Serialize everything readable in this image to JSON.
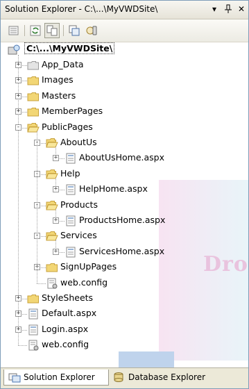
{
  "window": {
    "title": "Solution Explorer - C:\\...\\MyVWDSite\\",
    "dropdown_glyph": "▾",
    "pin_glyph": "⊥",
    "close_glyph": "✕"
  },
  "toolbar": {
    "buttons": [
      "properties-icon",
      "refresh-icon",
      "nest-related-files-icon",
      "copy-web-site-icon",
      "asp-net-configuration-icon"
    ]
  },
  "tree": {
    "root": "C:\\...\\MyVWDSite\\",
    "items": [
      {
        "label": "App_Data",
        "type": "folder-special",
        "level": 1,
        "expander": "+"
      },
      {
        "label": "Images",
        "type": "folder",
        "level": 1,
        "expander": "+"
      },
      {
        "label": "Masters",
        "type": "folder",
        "level": 1,
        "expander": "+"
      },
      {
        "label": "MemberPages",
        "type": "folder",
        "level": 1,
        "expander": "+"
      },
      {
        "label": "PublicPages",
        "type": "folder-open",
        "level": 1,
        "expander": "-"
      },
      {
        "label": "AboutUs",
        "type": "folder-open",
        "level": 2,
        "expander": "-"
      },
      {
        "label": "AboutUsHome.aspx",
        "type": "page",
        "level": 3,
        "expander": "+"
      },
      {
        "label": "Help",
        "type": "folder-open",
        "level": 2,
        "expander": "-"
      },
      {
        "label": "HelpHome.aspx",
        "type": "page",
        "level": 3,
        "expander": "+"
      },
      {
        "label": "Products",
        "type": "folder-open",
        "level": 2,
        "expander": "-"
      },
      {
        "label": "ProductsHome.aspx",
        "type": "page",
        "level": 3,
        "expander": "+"
      },
      {
        "label": "Services",
        "type": "folder-open",
        "level": 2,
        "expander": "-"
      },
      {
        "label": "ServicesHome.aspx",
        "type": "page",
        "level": 3,
        "expander": "+"
      },
      {
        "label": "SignUpPages",
        "type": "folder",
        "level": 2,
        "expander": "+"
      },
      {
        "label": "web.config",
        "type": "config",
        "level": 2,
        "expander": ""
      },
      {
        "label": "StyleSheets",
        "type": "folder",
        "level": 1,
        "expander": "+"
      },
      {
        "label": "Default.aspx",
        "type": "page",
        "level": 1,
        "expander": "+"
      },
      {
        "label": "Login.aspx",
        "type": "page",
        "level": 1,
        "expander": "+"
      },
      {
        "label": "web.config",
        "type": "config",
        "level": 1,
        "expander": ""
      }
    ]
  },
  "watermark": {
    "text": "Dro"
  },
  "tabs": [
    {
      "label": "Solution Explorer",
      "active": true
    },
    {
      "label": "Database Explorer",
      "active": false
    }
  ],
  "colors": {
    "folder": "#f2d675",
    "folder_edge": "#c8a23c",
    "border": "#7f9db9"
  }
}
